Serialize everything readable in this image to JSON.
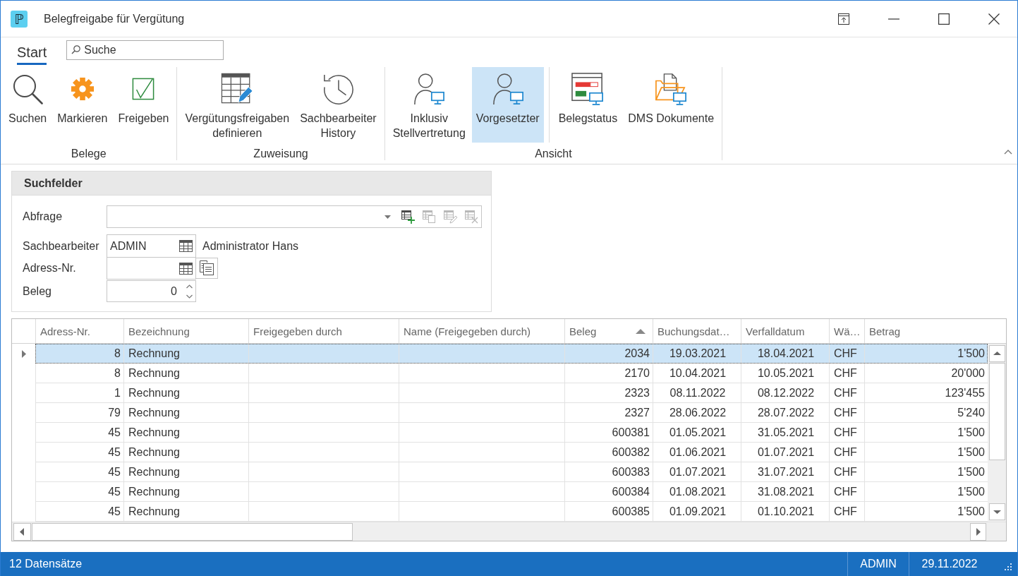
{
  "window": {
    "logo": "ℙ",
    "title": "Belegfreigabe für Vergütung"
  },
  "ribbon": {
    "tabs": [
      {
        "label": "Start",
        "selected": true
      }
    ],
    "search": {
      "placeholder": "Suche"
    },
    "groups": [
      {
        "label": "Belege",
        "sections": [
          {
            "buttons": [
              {
                "label": "Suchen",
                "kind": "search",
                "selected": false
              },
              {
                "label": "Markieren",
                "kind": "gear",
                "selected": false
              },
              {
                "label": "Freigeben",
                "kind": "check",
                "selected": false
              }
            ]
          }
        ]
      },
      {
        "label": "Zuweisung",
        "sections": [
          {
            "buttons": [
              {
                "label": "Vergütungsfreigaben\ndefinieren",
                "kind": "table_edit",
                "selected": false
              },
              {
                "label": "Sachbearbeiter\nHistory",
                "kind": "history",
                "selected": false
              }
            ]
          }
        ]
      },
      {
        "label": "Ansicht",
        "sections": [
          {
            "buttons": [
              {
                "label": "Inklusiv\nStellvertretung",
                "kind": "user_monitor",
                "selected": false
              },
              {
                "label": "Vorgesetzter",
                "kind": "user_monitor",
                "selected": true
              }
            ]
          },
          {
            "buttons": [
              {
                "label": "Belegstatus",
                "kind": "status",
                "selected": false
              },
              {
                "label": "DMS Dokumente",
                "kind": "folder",
                "selected": false
              }
            ]
          }
        ]
      }
    ]
  },
  "search_panel": {
    "title": "Suchfelder",
    "fields": [
      {
        "label": "Abfrage",
        "kind": "combo",
        "actions": [
          {
            "kind": "add",
            "disabled": false
          },
          {
            "kind": "copy",
            "disabled": true
          },
          {
            "kind": "edit",
            "disabled": true
          },
          {
            "kind": "delete",
            "disabled": true
          }
        ]
      },
      {
        "label": "Sachbearbeiter",
        "kind": "lookup",
        "value": "ADMIN",
        "description": "Administrator Hans"
      },
      {
        "label": "Adress-Nr.",
        "kind": "lookup_copy"
      },
      {
        "label": "Beleg",
        "kind": "spin",
        "value": "0"
      }
    ]
  },
  "grid": {
    "columns": [
      {
        "label": "Adress-Nr.",
        "sorted": false
      },
      {
        "label": "Bezeichnung",
        "sorted": false
      },
      {
        "label": "Freigegeben durch",
        "sorted": false
      },
      {
        "label": "Name (Freigegeben durch)",
        "sorted": false
      },
      {
        "label": "Beleg",
        "sorted": true
      },
      {
        "label": "Buchungsdat…",
        "sorted": false
      },
      {
        "label": "Verfalldatum",
        "sorted": false
      },
      {
        "label": "Wä…",
        "sorted": false
      },
      {
        "label": "Betrag",
        "sorted": false
      }
    ],
    "rows": [
      {
        "selected": true,
        "adress_nr": "8",
        "bezeichnung": "Rechnung",
        "beleg": "2034",
        "buchungsdat": "19.03.2021",
        "verfalldatum": "18.04.2021",
        "wae": "CHF",
        "betrag": "1'500"
      },
      {
        "selected": false,
        "adress_nr": "8",
        "bezeichnung": "Rechnung",
        "beleg": "2170",
        "buchungsdat": "10.04.2021",
        "verfalldatum": "10.05.2021",
        "wae": "CHF",
        "betrag": "20'000"
      },
      {
        "selected": false,
        "adress_nr": "1",
        "bezeichnung": "Rechnung",
        "beleg": "2323",
        "buchungsdat": "08.11.2022",
        "verfalldatum": "08.12.2022",
        "wae": "CHF",
        "betrag": "123'455"
      },
      {
        "selected": false,
        "adress_nr": "79",
        "bezeichnung": "Rechnung",
        "beleg": "2327",
        "buchungsdat": "28.06.2022",
        "verfalldatum": "28.07.2022",
        "wae": "CHF",
        "betrag": "5'240"
      },
      {
        "selected": false,
        "adress_nr": "45",
        "bezeichnung": "Rechnung",
        "beleg": "600381",
        "buchungsdat": "01.05.2021",
        "verfalldatum": "31.05.2021",
        "wae": "CHF",
        "betrag": "1'500"
      },
      {
        "selected": false,
        "adress_nr": "45",
        "bezeichnung": "Rechnung",
        "beleg": "600382",
        "buchungsdat": "01.06.2021",
        "verfalldatum": "01.07.2021",
        "wae": "CHF",
        "betrag": "1'500"
      },
      {
        "selected": false,
        "adress_nr": "45",
        "bezeichnung": "Rechnung",
        "beleg": "600383",
        "buchungsdat": "01.07.2021",
        "verfalldatum": "31.07.2021",
        "wae": "CHF",
        "betrag": "1'500"
      },
      {
        "selected": false,
        "adress_nr": "45",
        "bezeichnung": "Rechnung",
        "beleg": "600384",
        "buchungsdat": "01.08.2021",
        "verfalldatum": "31.08.2021",
        "wae": "CHF",
        "betrag": "1'500"
      },
      {
        "selected": false,
        "adress_nr": "45",
        "bezeichnung": "Rechnung",
        "beleg": "600385",
        "buchungsdat": "01.09.2021",
        "verfalldatum": "01.10.2021",
        "wae": "CHF",
        "betrag": "1'500"
      }
    ]
  },
  "status_bar": {
    "record_count": "12 Datensätze",
    "user": "ADMIN",
    "date": "29.11.2022"
  }
}
